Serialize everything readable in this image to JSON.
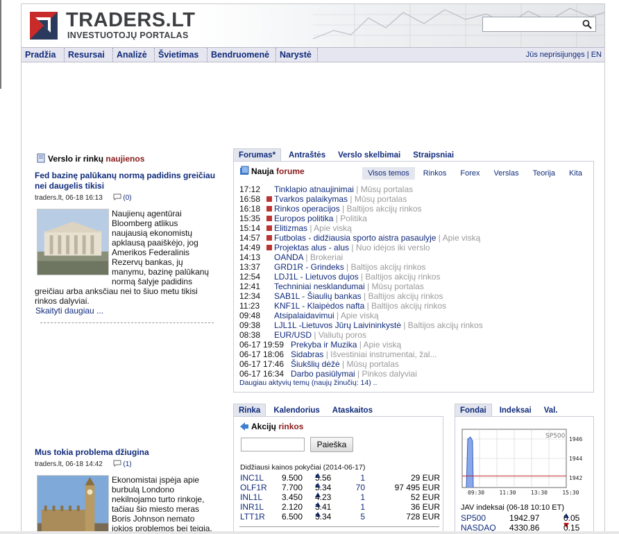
{
  "header": {
    "logo_title": "TRADERS.LT",
    "logo_subtitle": "INVESTUOTOJŲ PORTALAS",
    "search_placeholder": ""
  },
  "nav": {
    "items": [
      "Pradžia",
      "Resursai",
      "Analizė",
      "Švietimas",
      "Bendruomenė",
      "Narystė"
    ],
    "login": "Jūs neprisijungęs | EN"
  },
  "news": {
    "heading_a": "Verslo ir rinkų ",
    "heading_b": "naujienos",
    "articles": [
      {
        "title": "Fed bazinę palūkanų normą padidins greičiau nei daugelis tikisi",
        "meta": "traders.lt, 06-18 16:13",
        "comments": "(0)",
        "text_side": [
          "Naujienų agentūrai",
          "Bloomberg atlikus",
          "naujausią ekonomistų",
          "apklausą paaiškėjo, jog",
          "Amerikos Federalinis",
          "Rezervų bankas, jų",
          "manymu, bazinę palūkanų",
          "normą šalyje padidins"
        ],
        "text_full": [
          "greičiau arba anksčiau nei to šiuo metu tikisi",
          "rinkos dalyviai."
        ],
        "more": "Skaityti daugiau ..."
      },
      {
        "title": "Mus tokia problema džiugina",
        "meta": "traders.lt, 06-18 14:42",
        "comments": "(1)",
        "text_side": [
          "Ekonomistai įspėja apie",
          "burbulą Londono",
          "nekilnojamo turto rinkoje,",
          "tačiau šio miesto meras",
          "Boris Johnson nemato",
          "jokios problemos bei teigia,"
        ],
        "text_full": [],
        "more": ""
      }
    ]
  },
  "forum": {
    "tabs": [
      "Forumas*",
      "Antraštės",
      "Verslo skelbimai",
      "Straipsniai"
    ],
    "title_a": "Nauja ",
    "title_b": "forume",
    "subtabs": [
      "Visos temos",
      "Rinkos",
      "Forex",
      "Verslas",
      "Teorija",
      "Kita"
    ],
    "rows": [
      {
        "time": "17:12",
        "hot": false,
        "topic": "Tinklapio atnaujinimai",
        "cat": "Mūsų portalas"
      },
      {
        "time": "16:58",
        "hot": true,
        "topic": "Tvarkos palaikymas",
        "cat": "Mūsų portalas"
      },
      {
        "time": "16:18",
        "hot": true,
        "topic": "Rinkos operacijos",
        "cat": "Baltijos akcijų rinkos"
      },
      {
        "time": "15:35",
        "hot": true,
        "topic": "Europos politika",
        "cat": "Politika"
      },
      {
        "time": "15:14",
        "hot": true,
        "topic": "Elitizmas",
        "cat": "Apie viską"
      },
      {
        "time": "14:57",
        "hot": true,
        "topic": "Futbolas - didžiausia sporto aistra pasaulyje",
        "cat": "Apie viską"
      },
      {
        "time": "14:49",
        "hot": true,
        "topic": "Projektas alus - alus",
        "cat": "Nuo idėjos iki verslo"
      },
      {
        "time": "14:13",
        "hot": false,
        "topic": "OANDA",
        "cat": "Brokeriai"
      },
      {
        "time": "13:37",
        "hot": false,
        "topic": "GRD1R - Grindeks",
        "cat": "Baltijos akcijų rinkos"
      },
      {
        "time": "12:54",
        "hot": false,
        "topic": "LDJ1L - Lietuvos dujos",
        "cat": "Baltijos akcijų rinkos"
      },
      {
        "time": "12:41",
        "hot": false,
        "topic": "Techniniai nesklandumai",
        "cat": "Mūsų portalas"
      },
      {
        "time": "12:34",
        "hot": false,
        "topic": "SAB1L - Šiaulių bankas",
        "cat": "Baltijos akcijų rinkos"
      },
      {
        "time": "11:23",
        "hot": false,
        "topic": "KNF1L - Klaipėdos nafta",
        "cat": "Baltijos akcijų rinkos"
      },
      {
        "time": "09:48",
        "hot": false,
        "topic": "Atsipalaidavimui",
        "cat": "Apie viską"
      },
      {
        "time": "09:38",
        "hot": false,
        "topic": "LJL1L -Lietuvos Jūrų Laivininkystė",
        "cat": "Baltijos akcijų rinkos"
      },
      {
        "time": "08:38",
        "hot": false,
        "topic": "EUR/USD",
        "cat": "Valiutų poros"
      },
      {
        "time": "06-17 19:59",
        "hot": false,
        "topic": "Prekyba ir Muzika",
        "cat": "Apie viską"
      },
      {
        "time": "06-17 18:06",
        "hot": false,
        "topic": "Sidabras",
        "cat": "Išvestiniai instrumentai, žal..."
      },
      {
        "time": "06-17 17:46",
        "hot": false,
        "topic": "Šiukšlių dėžė",
        "cat": "Mūsų portalas"
      },
      {
        "time": "06-17 16:34",
        "hot": false,
        "topic": "Darbo pasiūlymai",
        "cat": "Pinkos dalyviai"
      }
    ],
    "more": "Daugiau aktyvių temų (naujų žinučių: 14) .."
  },
  "market": {
    "tabs": [
      "Rinka",
      "Kalendorius",
      "Ataskaitos"
    ],
    "title_a": "Akcijų ",
    "title_b": "rinkos",
    "search_button": "Paieška",
    "changes_title": "Didžiausi kainos pokyčiai (2014-06-17)",
    "rows": [
      {
        "ticker": "INC1L",
        "price": "9.500",
        "change": "5.56",
        "trades": "1",
        "volume": "29 EUR"
      },
      {
        "ticker": "OLF1R",
        "price": "7.700",
        "change": "5.34",
        "trades": "70",
        "volume": "97 495 EUR"
      },
      {
        "ticker": "INL1L",
        "price": "3.450",
        "change": "4.23",
        "trades": "1",
        "volume": "52 EUR"
      },
      {
        "ticker": "INR1L",
        "price": "2.120",
        "change": "3.41",
        "trades": "1",
        "volume": "36 EUR"
      },
      {
        "ticker": "LTT1R",
        "price": "6.500",
        "change": "3.34",
        "trades": "5",
        "volume": "728 EUR"
      }
    ]
  },
  "funds": {
    "tabs": [
      "Fondai",
      "Indeksai",
      "Val."
    ],
    "indices_title": "JAV indeksai (06-18 10:10 ET)",
    "rows": [
      {
        "name": "SP500",
        "value": "1942.97",
        "dir": "up",
        "change": "0.05"
      },
      {
        "name": "NASDAQ",
        "value": "4330.86",
        "dir": "down",
        "change": "0.15"
      }
    ]
  },
  "chart_data": {
    "type": "line",
    "title": "SP500",
    "x": [
      "09:30",
      "11:30",
      "13:30",
      "15:30"
    ],
    "yticks": [
      "1946",
      "1944",
      "1942"
    ],
    "ylim": [
      1941,
      1947
    ],
    "series": [
      {
        "name": "SP500",
        "values": [
          1941,
          1946,
          1946.2,
          1945.8,
          1941
        ]
      }
    ],
    "reference_line": 1942.2,
    "grid": true,
    "colors": {
      "area": "#7a9ee8",
      "ref": "#c0202a"
    }
  },
  "colors": {
    "link": "#0f2a7a",
    "accent": "#8a1a1a",
    "gray": "#9a9a9a",
    "tab_bg": "#e3e6ee"
  }
}
